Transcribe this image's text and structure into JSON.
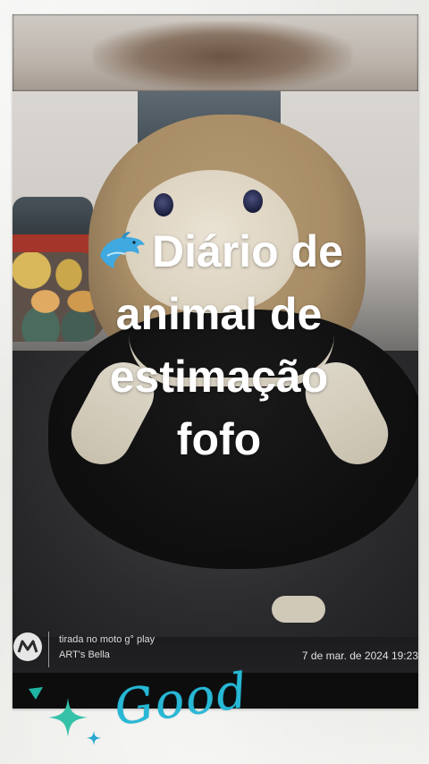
{
  "title": {
    "line1": "Diário de",
    "line2": "animal de",
    "line3": "estimação",
    "line4": "fofo",
    "emoji": "dolphin-icon"
  },
  "watermark": {
    "line1": "tirada no moto g° play",
    "line2": "ART's Bella",
    "date": "7 de mar. de 2024 19:23"
  },
  "sticker": {
    "text": "Good"
  },
  "colors": {
    "title": "#ffffff",
    "sticker": "#27b8d6",
    "background": "#efefec"
  }
}
